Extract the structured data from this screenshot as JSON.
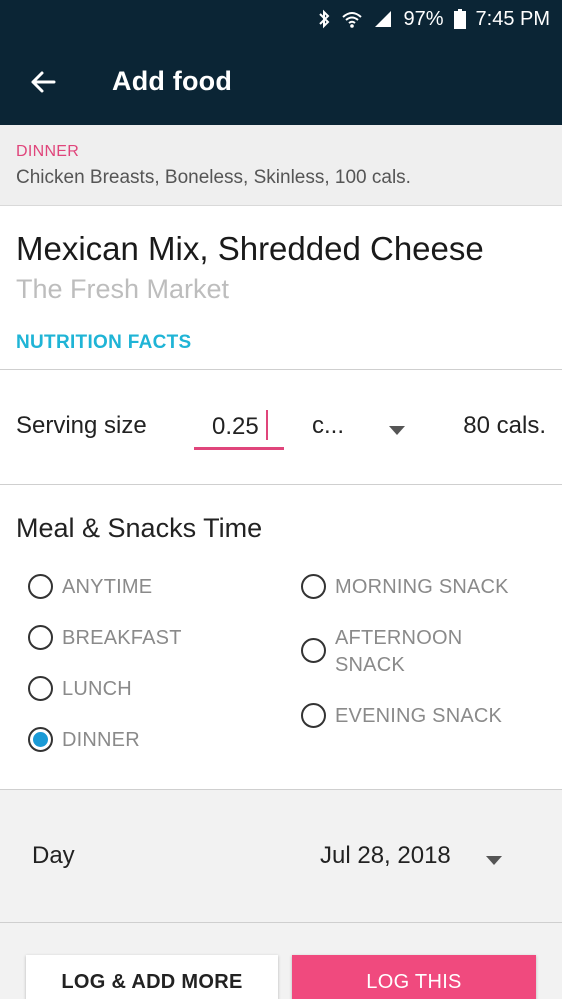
{
  "status_bar": {
    "battery": "97%",
    "time": "7:45 PM",
    "icons": [
      "bluetooth-icon",
      "wifi-icon",
      "signal-icon",
      "battery-icon"
    ]
  },
  "app_bar": {
    "title": "Add food",
    "back_icon": "arrow-left-icon"
  },
  "logged_item": {
    "meal": "DINNER",
    "description": "Chicken Breasts, Boneless, Skinless, 100 cals."
  },
  "food": {
    "name": "Mexican Mix, Shredded Cheese",
    "brand": "The Fresh Market",
    "nutrition_link": "NUTRITION FACTS"
  },
  "serving": {
    "label": "Serving size",
    "quantity": "0.25",
    "unit": "c...",
    "calories": "80 cals."
  },
  "meal_time": {
    "header": "Meal & Snacks Time",
    "options": [
      {
        "label": "ANYTIME",
        "selected": false
      },
      {
        "label": "BREAKFAST",
        "selected": false
      },
      {
        "label": "LUNCH",
        "selected": false
      },
      {
        "label": "DINNER",
        "selected": true
      },
      {
        "label": "MORNING SNACK",
        "selected": false
      },
      {
        "label": "AFTERNOON SNACK",
        "selected": false
      },
      {
        "label": "EVENING SNACK",
        "selected": false
      }
    ]
  },
  "day": {
    "label": "Day",
    "value": "Jul 28, 2018"
  },
  "actions": {
    "log_add_more": "LOG & ADD MORE",
    "log_this": "LOG THIS"
  },
  "colors": {
    "app_bar": "#0b2535",
    "accent_pink": "#f04a7e",
    "link_cyan": "#1fb4d6",
    "radio_selected": "#1a9ad6"
  }
}
